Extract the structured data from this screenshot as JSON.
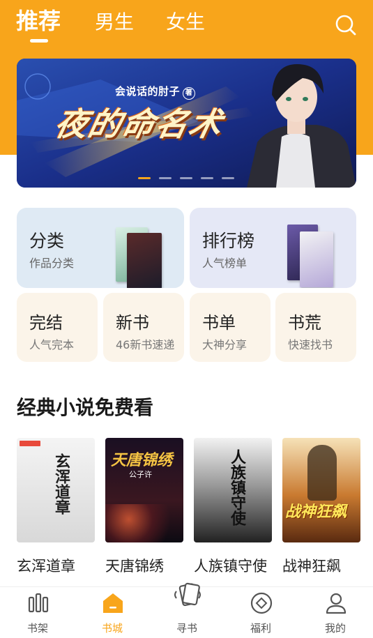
{
  "header": {
    "tabs": [
      {
        "label": "推荐",
        "active": true
      },
      {
        "label": "男生",
        "active": false
      },
      {
        "label": "女生",
        "active": false
      }
    ],
    "search_icon": "search-icon"
  },
  "banner": {
    "author": "会说话的肘子",
    "author_mark": "著",
    "title": "夜的命名术",
    "slide_count": 5,
    "active_slide": 1
  },
  "categories": {
    "big": [
      {
        "title": "分类",
        "subtitle": "作品分类",
        "bg": "#dfeaf4"
      },
      {
        "title": "排行榜",
        "subtitle": "人气榜单",
        "bg": "#e5e8f6"
      }
    ],
    "small": [
      {
        "title": "完结",
        "subtitle": "人气完本"
      },
      {
        "title": "新书",
        "subtitle": "46新书速递"
      },
      {
        "title": "书单",
        "subtitle": "大神分享"
      },
      {
        "title": "书荒",
        "subtitle": "快速找书"
      }
    ],
    "small_bg": "#fbf4e9"
  },
  "section": {
    "title": "经典小说免费看"
  },
  "books": [
    {
      "name": "玄浑道章",
      "cover_text": "玄浑道章"
    },
    {
      "name": "天唐锦绣",
      "cover_text": "天唐锦绣",
      "cover_author": "公子许"
    },
    {
      "name": "人族镇守使",
      "cover_text": "人族镇守使"
    },
    {
      "name": "战神狂飙",
      "cover_text": "战神狂飙"
    }
  ],
  "bottom_nav": [
    {
      "label": "书架",
      "icon": "bookshelf-icon",
      "active": false
    },
    {
      "label": "书城",
      "icon": "bookstore-icon",
      "active": true
    },
    {
      "label": "寻书",
      "icon": "find-book-icon",
      "active": false
    },
    {
      "label": "福利",
      "icon": "welfare-icon",
      "active": false
    },
    {
      "label": "我的",
      "icon": "profile-icon",
      "active": false
    }
  ],
  "colors": {
    "accent": "#f8a51b",
    "banner_bg": "#1b2a6b"
  }
}
